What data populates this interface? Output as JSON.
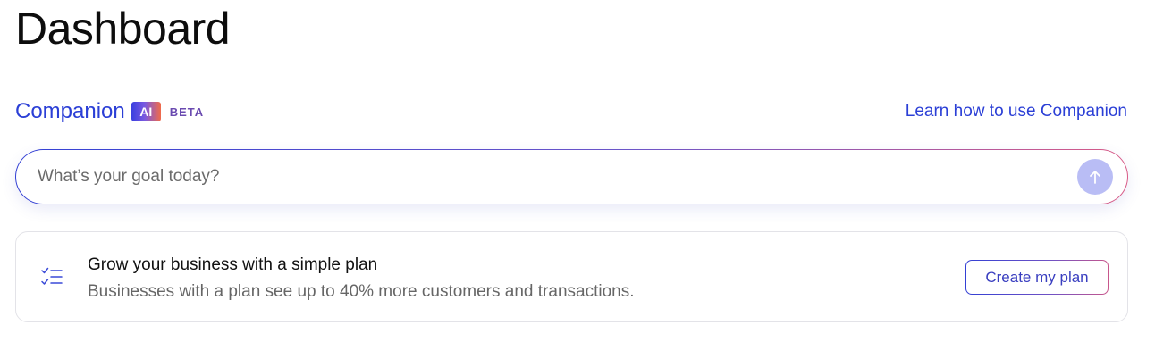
{
  "page": {
    "title": "Dashboard"
  },
  "companion": {
    "title": "Companion",
    "ai_badge": "AI",
    "beta_label": "BETA",
    "learn_link": "Learn how to use Companion"
  },
  "goal_input": {
    "placeholder": "What’s your goal today?",
    "value": ""
  },
  "plan_card": {
    "title": "Grow your business with a simple plan",
    "description": "Businesses with a plan see up to 40% more customers and transactions.",
    "button_label": "Create my plan"
  },
  "icons": {
    "send": "arrow-up-icon",
    "plan": "checklist-icon"
  },
  "colors": {
    "accent": "#2b3fd6",
    "send_button": "#b9bdf5",
    "badge_gradient_start": "#3a3fe0",
    "badge_gradient_end": "#f06a4a"
  }
}
